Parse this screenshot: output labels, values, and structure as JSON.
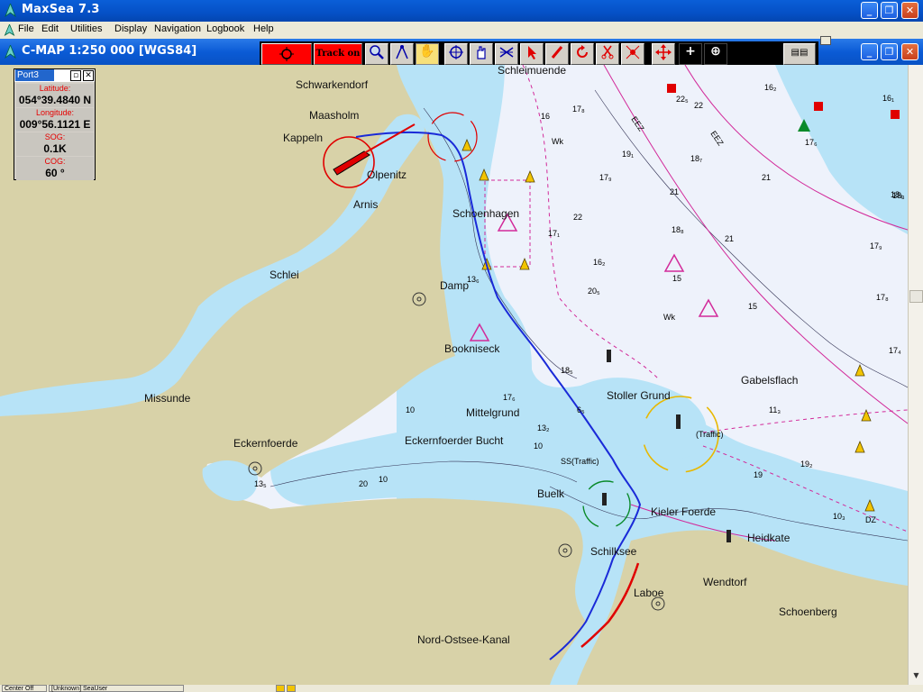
{
  "window": {
    "title": "MaxSea 7.3"
  },
  "menu": [
    "File",
    "Edit",
    "Utilities",
    "Display",
    "Navigation",
    "Logbook",
    "Help"
  ],
  "chart_window": {
    "title": "C-MAP  1:250 000 [WGS84]"
  },
  "toolbar": {
    "track_label": "Track on"
  },
  "port_panel": {
    "name": "Port3",
    "latitude_label": "Latitude:",
    "latitude": "054°39.4840 N",
    "longitude_label": "Longitude:",
    "longitude": "009°56.1121 E",
    "sog_label": "SOG:",
    "sog": "0.1K",
    "cog_label": "COG:",
    "cog": "60 °"
  },
  "places": [
    "Schwarkendorf",
    "Maasholm",
    "Kappeln",
    "Olpenitz",
    "Arnis",
    "Schoenhagen",
    "Schlei",
    "Damp",
    "Bookniseck",
    "Missunde",
    "Mittelgrund",
    "Eckernfoerder Bucht",
    "Eckernfoerde",
    "Stoller Grund",
    "Gabelsflach",
    "Buelk",
    "Kieler Foerde",
    "Heidkate",
    "Schilksee",
    "Wendtorf",
    "Laboe",
    "Schoenberg",
    "Nord-Ostsee-Kanal",
    "Schleimuende"
  ],
  "depth_labels": [
    "16₂",
    "17₈",
    "16",
    "19₁",
    "18₇",
    "21",
    "17₉",
    "21",
    "22",
    "18₈",
    "21",
    "16₂",
    "17₁",
    "20₅",
    "15",
    "15",
    "13₆",
    "17₆",
    "13₂",
    "18₅",
    "6₅",
    "11₃",
    "19",
    "19₂",
    "10₃",
    "17₈",
    "17₄",
    "18₃",
    "17₉",
    "22₅",
    "16₁",
    "10",
    "10",
    "20",
    "10",
    "13₅",
    "22",
    "18₃",
    "17₆"
  ],
  "chart_labels": {
    "traffic1": "(Traffic)",
    "traffic2": "SS(Traffic)",
    "ez": "EEZ",
    "wk": "Wk",
    "dz": "DZ"
  },
  "statusbar": {
    "left": "Center Off",
    "user": "[Unknown] SeaUser"
  },
  "colors": {
    "land": "#d8d2a8",
    "shallow": "#b7e3f7",
    "deep": "#eef2fb",
    "track": "#1a2ad8",
    "vessel": "#d00000"
  }
}
